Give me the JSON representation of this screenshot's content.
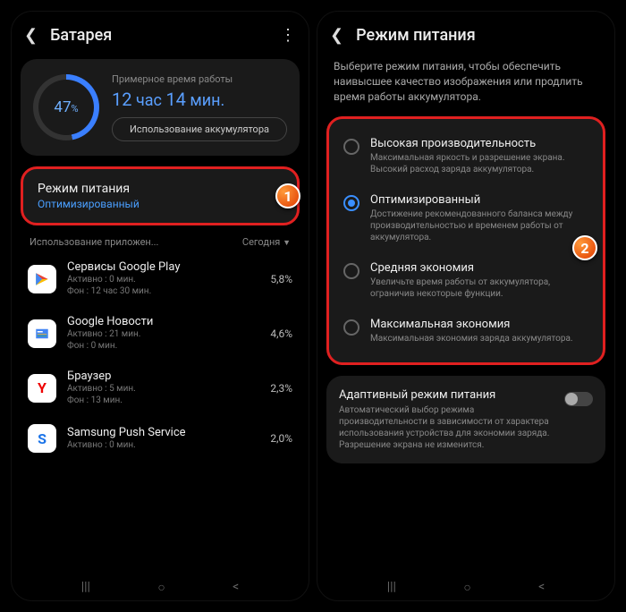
{
  "left": {
    "header": {
      "title": "Батарея"
    },
    "battery": {
      "percent": "47",
      "percent_suffix": "%",
      "est_label": "Примерное время работы",
      "hours": "12",
      "hours_unit": "час",
      "mins": "14",
      "mins_unit": "мин.",
      "usage_btn": "Использование аккумулятора"
    },
    "power_mode": {
      "title": "Режим питания",
      "value": "Оптимизированный",
      "badge": "1"
    },
    "apps_header": {
      "left": "Использование приложен...",
      "right": "Сегодня"
    },
    "apps": [
      {
        "name": "Сервисы Google Play",
        "active": "Активно : 0 мин.",
        "bg": "Фон : 12 час 30 мин.",
        "pct": "5,8%"
      },
      {
        "name": "Google Новости",
        "active": "Активно : 21 мин.",
        "bg": "Фон : 0 мин.",
        "pct": "4,6%"
      },
      {
        "name": "Браузер",
        "active": "Активно : 5 мин.",
        "bg": "Фон : 13 мин.",
        "pct": "2,3%"
      },
      {
        "name": "Samsung Push Service",
        "active": "Активно : 0 мин.",
        "bg": "",
        "pct": "2,0%"
      }
    ]
  },
  "right": {
    "header": {
      "title": "Режим питания"
    },
    "desc": "Выберите режим питания, чтобы обеспечить наивысшее качество изображения или продлить время работы аккумулятора.",
    "badge": "2",
    "modes": [
      {
        "title": "Высокая производительность",
        "sub": "Максимальная яркость и разрешение экрана. Высокий расход заряда аккумулятора.",
        "selected": false
      },
      {
        "title": "Оптимизированный",
        "sub": "Достижение рекомендованного баланса между производительностью и временем работы от аккумулятора.",
        "selected": true
      },
      {
        "title": "Средняя экономия",
        "sub": "Увеличьте время работы от аккумулятора, ограничив некоторые функции.",
        "selected": false
      },
      {
        "title": "Максимальная экономия",
        "sub": "Максимальная экономия заряда аккумулятора.",
        "selected": false
      }
    ],
    "adaptive": {
      "title": "Адаптивный режим питания",
      "sub": "Автоматический выбор режима производительности в зависимости от характера использования устройства для экономии заряда. Разрешение экрана не изменится."
    }
  }
}
